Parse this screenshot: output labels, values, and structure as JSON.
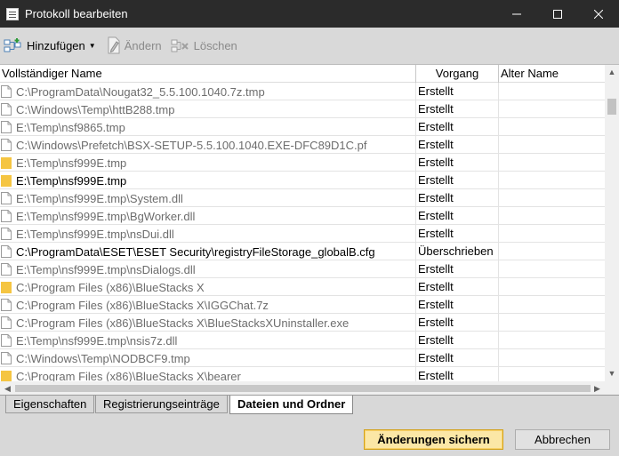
{
  "window": {
    "title": "Protokoll bearbeiten",
    "minimize_glyph": "—",
    "maximize_glyph": "☐",
    "close_glyph": "✕"
  },
  "toolbar": {
    "add_label": "Hinzufügen",
    "edit_label": "Ändern",
    "delete_label": "Löschen"
  },
  "list": {
    "columns": [
      "Vollständiger Name",
      "Vorgang",
      "Alter Name"
    ],
    "rows": [
      {
        "name": "C:\\ProgramData\\Nougat32_5.5.100.1040.7z.tmp",
        "operation": "Erstellt",
        "old_name": "",
        "icon": "file",
        "strong": false
      },
      {
        "name": "C:\\Windows\\Temp\\httB288.tmp",
        "operation": "Erstellt",
        "old_name": "",
        "icon": "file",
        "strong": false
      },
      {
        "name": "E:\\Temp\\nsf9865.tmp",
        "operation": "Erstellt",
        "old_name": "",
        "icon": "file",
        "strong": false
      },
      {
        "name": "C:\\Windows\\Prefetch\\BSX-SETUP-5.5.100.1040.EXE-DFC89D1C.pf",
        "operation": "Erstellt",
        "old_name": "",
        "icon": "file",
        "strong": false
      },
      {
        "name": "E:\\Temp\\nsf999E.tmp",
        "operation": "Erstellt",
        "old_name": "",
        "icon": "folder",
        "strong": false
      },
      {
        "name": "E:\\Temp\\nsf999E.tmp",
        "operation": "Erstellt",
        "old_name": "",
        "icon": "folder",
        "strong": true
      },
      {
        "name": "E:\\Temp\\nsf999E.tmp\\System.dll",
        "operation": "Erstellt",
        "old_name": "",
        "icon": "file",
        "strong": false
      },
      {
        "name": "E:\\Temp\\nsf999E.tmp\\BgWorker.dll",
        "operation": "Erstellt",
        "old_name": "",
        "icon": "file",
        "strong": false
      },
      {
        "name": "E:\\Temp\\nsf999E.tmp\\nsDui.dll",
        "operation": "Erstellt",
        "old_name": "",
        "icon": "file",
        "strong": false
      },
      {
        "name": "C:\\ProgramData\\ESET\\ESET Security\\registryFileStorage_globalB.cfg",
        "operation": "Überschrieben",
        "old_name": "",
        "icon": "file",
        "strong": true
      },
      {
        "name": "E:\\Temp\\nsf999E.tmp\\nsDialogs.dll",
        "operation": "Erstellt",
        "old_name": "",
        "icon": "file",
        "strong": false
      },
      {
        "name": "C:\\Program Files (x86)\\BlueStacks X",
        "operation": "Erstellt",
        "old_name": "",
        "icon": "folder",
        "strong": false
      },
      {
        "name": "C:\\Program Files (x86)\\BlueStacks X\\IGGChat.7z",
        "operation": "Erstellt",
        "old_name": "",
        "icon": "file",
        "strong": false
      },
      {
        "name": "C:\\Program Files (x86)\\BlueStacks X\\BlueStacksXUninstaller.exe",
        "operation": "Erstellt",
        "old_name": "",
        "icon": "file",
        "strong": false
      },
      {
        "name": "E:\\Temp\\nsf999E.tmp\\nsis7z.dll",
        "operation": "Erstellt",
        "old_name": "",
        "icon": "file",
        "strong": false
      },
      {
        "name": "C:\\Windows\\Temp\\NODBCF9.tmp",
        "operation": "Erstellt",
        "old_name": "",
        "icon": "file",
        "strong": false
      },
      {
        "name": "C:\\Program Files (x86)\\BlueStacks X\\bearer",
        "operation": "Erstellt",
        "old_name": "",
        "icon": "folder",
        "strong": false
      }
    ]
  },
  "tabs": [
    {
      "label": "Eigenschaften",
      "active": false
    },
    {
      "label": "Registrierungseinträge",
      "active": false
    },
    {
      "label": "Dateien und Ordner",
      "active": true
    }
  ],
  "buttons": {
    "save_label": "Änderungen sichern",
    "cancel_label": "Abbrechen"
  },
  "colors": {
    "titlebar": "#2b2b2b",
    "folder": "#f5c542",
    "primary_button": "#fbe7a6"
  }
}
